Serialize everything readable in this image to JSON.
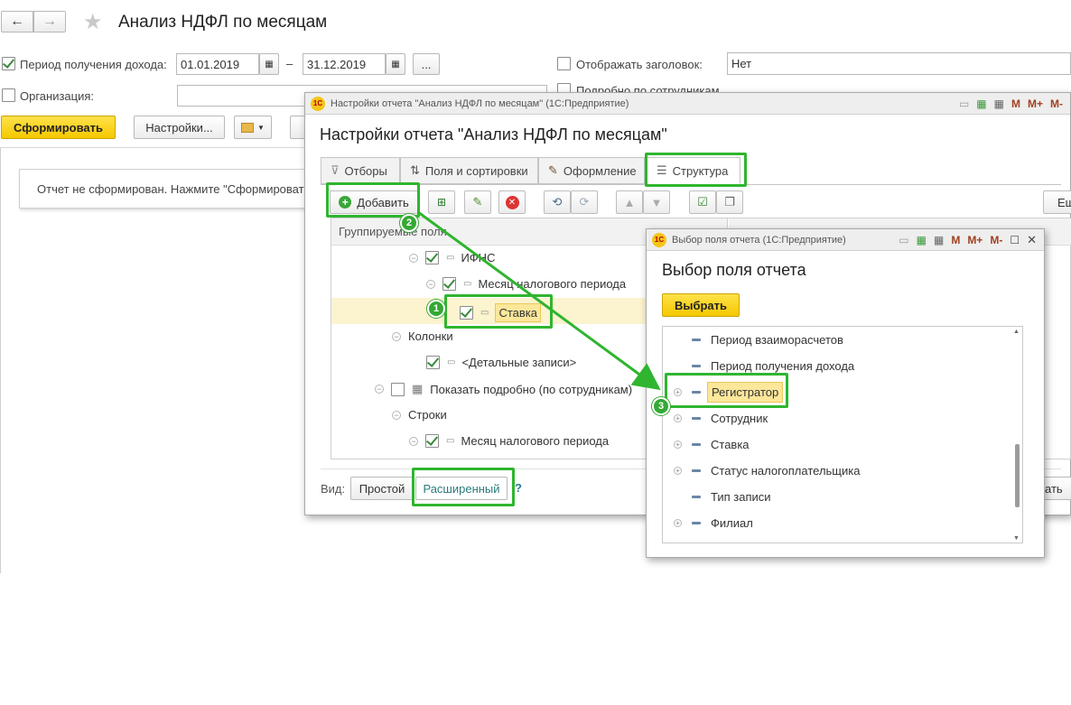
{
  "main": {
    "title": "Анализ НДФЛ по месяцам",
    "nav_back": "←",
    "nav_forward": "→",
    "star": "★",
    "period_label": "Период получения дохода:",
    "date_from": "01.01.2019",
    "date_to": "31.12.2019",
    "dash": "–",
    "ellipsis": "...",
    "org_label": "Организация:",
    "show_header_label": "Отображать заголовок:",
    "show_header_value": "Нет",
    "detail_by_employee_label": "Подробно по сотрудникам",
    "generate_button": "Сформировать",
    "settings_button": "Настройки...",
    "report_message": "Отчет не сформирован. Нажмите \"Сформировать\""
  },
  "settings_window": {
    "titlebar": "Настройки отчета \"Анализ НДФЛ по месяцам\"  (1С:Предприятие)",
    "heading": "Настройки отчета \"Анализ НДФЛ по месяцам\"",
    "tabs": [
      {
        "label": "Отборы",
        "icon": "filter-icon"
      },
      {
        "label": "Поля и сортировки",
        "icon": "sort-icon"
      },
      {
        "label": "Оформление",
        "icon": "brush-icon"
      },
      {
        "label": "Структура",
        "icon": "structure-icon"
      }
    ],
    "add_button": "Добавить",
    "right_cut_button": "Ещ",
    "tree_header": "Группируемые поля",
    "tree": [
      {
        "label": "ИФНС",
        "checked": true
      },
      {
        "label": "Месяц налогового периода",
        "checked": true
      },
      {
        "label": "Ставка",
        "checked": true
      },
      {
        "label": "Колонки"
      },
      {
        "label": "<Детальные записи>",
        "checked": true
      },
      {
        "label": "Показать подробно (по сотрудникам)",
        "checked": false
      },
      {
        "label": "Строки"
      },
      {
        "label": "Месяц налогового периода",
        "checked": true
      }
    ],
    "view_label": "Вид:",
    "view_simple": "Простой",
    "view_advanced": "Расширенный",
    "help": "?",
    "cut_right": "ать"
  },
  "field_window": {
    "titlebar": "Выбор поля отчета  (1С:Предприятие)",
    "heading": "Выбор поля отчета",
    "select_button": "Выбрать",
    "items": [
      {
        "label": "Период взаиморасчетов",
        "expandable": false
      },
      {
        "label": "Период получения дохода",
        "expandable": false
      },
      {
        "label": "Регистратор",
        "expandable": true
      },
      {
        "label": "Сотрудник",
        "expandable": true
      },
      {
        "label": "Ставка",
        "expandable": true
      },
      {
        "label": "Статус налогоплательщика",
        "expandable": true
      },
      {
        "label": "Тип записи",
        "expandable": false
      },
      {
        "label": "Филиал",
        "expandable": true
      }
    ]
  },
  "annotations": {
    "badge1": "1",
    "badge2": "2",
    "badge3": "3"
  },
  "colors": {
    "annotation_green": "#2fb52f",
    "highlight_yellow": "#fce79a",
    "button_yellow": "#f5c800"
  }
}
